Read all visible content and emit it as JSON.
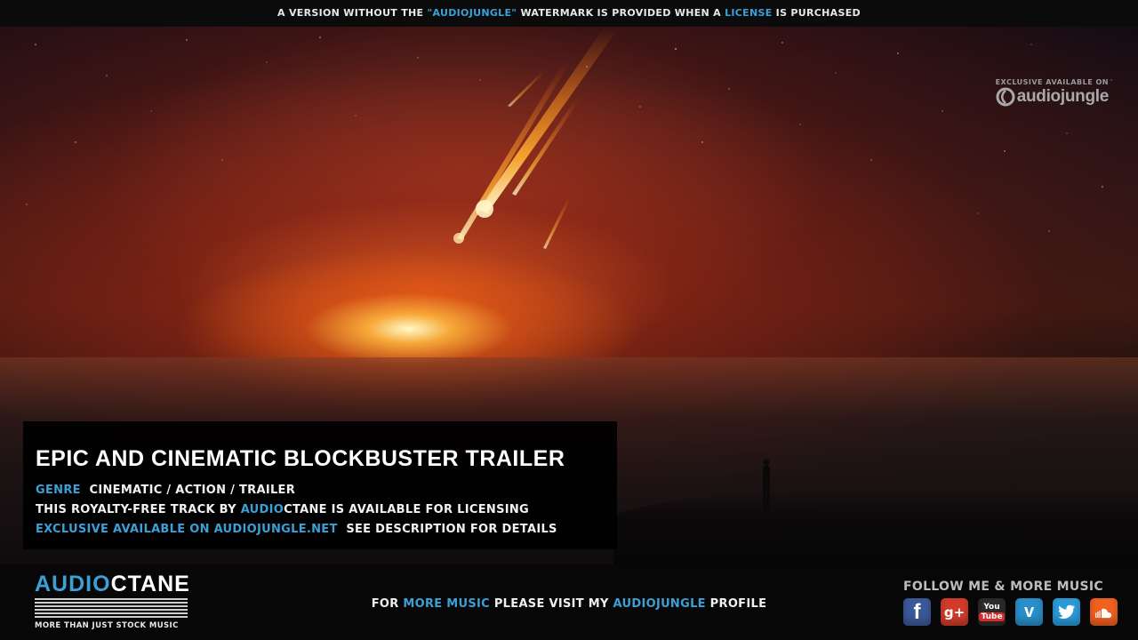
{
  "top_banner": {
    "part1": "A VERSION WITHOUT THE ",
    "accent1": "\"AUDIOJUNGLE\"",
    "part2": " WATERMARK IS PROVIDED WHEN A ",
    "accent2": "LICENSE",
    "part3": " IS PURCHASED"
  },
  "watermark": {
    "small": "EXCLUSIVE AVAILABLE ON",
    "brand": "audiojungle"
  },
  "info": {
    "title": "EPIC AND CINEMATIC BLOCKBUSTER TRAILER",
    "genre_label": "GENRE",
    "genre_value": "CINEMATIC / ACTION / TRAILER",
    "line2_part1": "THIS ROYALTY-FREE TRACK BY ",
    "line2_accent": "AUDIO",
    "line2_part2": "CTANE IS AVAILABLE FOR LICENSING",
    "line3_accent": "EXCLUSIVE AVAILABLE ON AUDIOJUNGLE.NET",
    "line3_rest": "SEE DESCRIPTION FOR DETAILS"
  },
  "footer": {
    "logo_part1": "AUDIO",
    "logo_part2": "CTANE",
    "logo_tagline": "MORE THAN JUST STOCK MUSIC",
    "visit_part1": "FOR ",
    "visit_accent1": "MORE MUSIC",
    "visit_part2": " PLEASE VISIT MY ",
    "visit_accent2": "AUDIOJUNGLE",
    "visit_part3": " PROFILE",
    "follow": "FOLLOW ME & MORE MUSIC",
    "social": {
      "facebook": "f",
      "googleplus": "g+",
      "youtube_you": "You",
      "youtube_tube": "Tube",
      "vimeo": "v"
    }
  },
  "colors": {
    "accent": "#3aa0d6",
    "facebook": "#3b5998",
    "googleplus": "#d13b2b",
    "vimeo": "#2a8ec9",
    "twitter": "#2b9ad8",
    "soundcloud": "#f06020"
  }
}
